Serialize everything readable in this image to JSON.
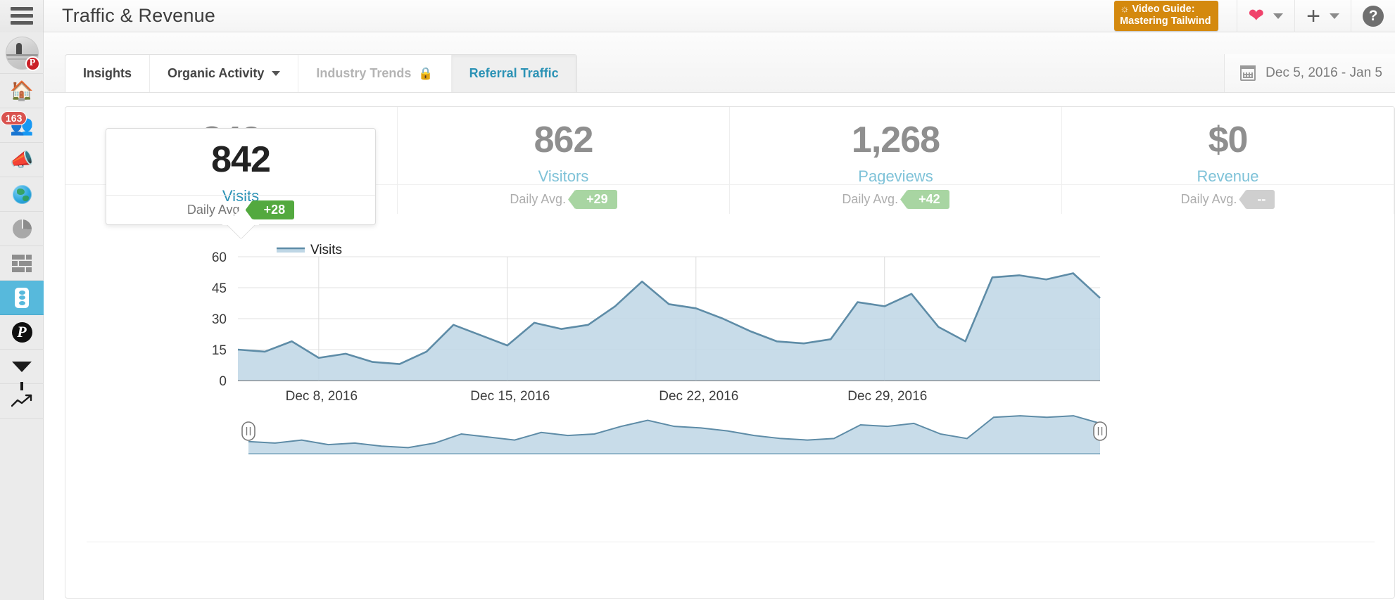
{
  "header": {
    "title": "Traffic & Revenue",
    "menu_icon": "hamburger-icon",
    "video_guide_line1": "Video Guide:",
    "video_guide_line2": "Mastering Tailwind",
    "video_guide_bulb": "♀",
    "heart_icon": "heart-icon",
    "plus_icon": "plus-icon",
    "help_icon": "question-mark-icon"
  },
  "sidebar": {
    "items": [
      {
        "name": "account-avatar",
        "icon": "avatar-pinterest-icon",
        "badge": ""
      },
      {
        "name": "home",
        "icon": "home-icon",
        "badge": ""
      },
      {
        "name": "community",
        "icon": "people-icon",
        "badge": "163"
      },
      {
        "name": "promote",
        "icon": "megaphone-icon",
        "badge": ""
      },
      {
        "name": "domain",
        "icon": "globe-icon",
        "badge": ""
      },
      {
        "name": "analytics",
        "icon": "pie-chart-icon",
        "badge": ""
      },
      {
        "name": "tiles",
        "icon": "grid-icon",
        "badge": ""
      },
      {
        "name": "traffic",
        "icon": "traffic-light-icon",
        "badge": ""
      },
      {
        "name": "pinterest",
        "icon": "pinterest-icon",
        "badge": ""
      },
      {
        "name": "funnel",
        "icon": "funnel-icon",
        "badge": ""
      },
      {
        "name": "trending",
        "icon": "trend-line-icon",
        "badge": ""
      }
    ],
    "active_index": 7
  },
  "tabs": [
    {
      "label": "Insights",
      "state": "normal",
      "has_caret": false,
      "has_lock": false
    },
    {
      "label": "Organic Activity",
      "state": "normal",
      "has_caret": true,
      "has_lock": false
    },
    {
      "label": "Industry Trends",
      "state": "disabled",
      "has_caret": false,
      "has_lock": true
    },
    {
      "label": "Referral Traffic",
      "state": "active",
      "has_caret": false,
      "has_lock": false
    }
  ],
  "date_range": {
    "icon": "calendar-icon",
    "value": "Dec 5, 2016 - Jan 5"
  },
  "kpis": [
    {
      "value": "842",
      "label": "Visits",
      "footer_label": "Daily Avg.",
      "delta": "+28",
      "delta_state": "positive",
      "active": true
    },
    {
      "value": "862",
      "label": "Visitors",
      "footer_label": "Daily Avg.",
      "delta": "+29",
      "delta_state": "positive",
      "active": false
    },
    {
      "value": "1,268",
      "label": "Pageviews",
      "footer_label": "Daily Avg.",
      "delta": "+42",
      "delta_state": "positive",
      "active": false
    },
    {
      "value": "$0",
      "label": "Revenue",
      "footer_label": "Daily Avg.",
      "delta": "--",
      "delta_state": "neutral",
      "active": false
    }
  ],
  "colors": {
    "accent": "#2b92b5",
    "kpi_label": "#7ec2d8",
    "badge_green": "#53a93f",
    "badge_green_muted": "#a8d5a2",
    "badge_gray": "#cfcfcf",
    "video_guide_bg": "#d4890e",
    "heart": "#f0426b",
    "sidebar_active": "#57b9dc",
    "series_line": "#5e8ca7",
    "series_fill": "#bed6e5"
  },
  "chart_data": {
    "type": "area",
    "title": "",
    "xlabel": "",
    "ylabel": "",
    "ylim": [
      0,
      60
    ],
    "yticks": [
      0,
      15,
      30,
      45,
      60
    ],
    "grid": true,
    "legend": {
      "position": "top-left",
      "entries": [
        "Visits"
      ]
    },
    "xtick_labels": [
      "Dec 8, 2016",
      "Dec 15, 2016",
      "Dec 22, 2016",
      "Dec 29, 2016"
    ],
    "xtick_indices": [
      3,
      10,
      17,
      24
    ],
    "x": [
      "Dec 5, 2016",
      "Dec 6, 2016",
      "Dec 7, 2016",
      "Dec 8, 2016",
      "Dec 9, 2016",
      "Dec 10, 2016",
      "Dec 11, 2016",
      "Dec 12, 2016",
      "Dec 13, 2016",
      "Dec 14, 2016",
      "Dec 15, 2016",
      "Dec 16, 2016",
      "Dec 17, 2016",
      "Dec 18, 2016",
      "Dec 19, 2016",
      "Dec 20, 2016",
      "Dec 21, 2016",
      "Dec 22, 2016",
      "Dec 23, 2016",
      "Dec 24, 2016",
      "Dec 25, 2016",
      "Dec 26, 2016",
      "Dec 27, 2016",
      "Dec 28, 2016",
      "Dec 29, 2016",
      "Dec 30, 2016",
      "Dec 31, 2016",
      "Jan 1, 2017",
      "Jan 2, 2017",
      "Jan 3, 2017",
      "Jan 4, 2017",
      "Jan 5, 2017"
    ],
    "series": [
      {
        "name": "Visits",
        "values": [
          15,
          14,
          19,
          11,
          13,
          9,
          8,
          14,
          27,
          22,
          17,
          28,
          25,
          27,
          36,
          48,
          37,
          35,
          30,
          24,
          19,
          18,
          20,
          38,
          36,
          42,
          26,
          19,
          50,
          51,
          49,
          52,
          40
        ]
      }
    ],
    "range_slider": {
      "visible": true,
      "left_handle": "left-range-handle",
      "right_handle": "right-range-handle",
      "overview_values": [
        8,
        7,
        9,
        6,
        7,
        5,
        4,
        7,
        13,
        11,
        9,
        14,
        12,
        13,
        18,
        22,
        18,
        17,
        15,
        12,
        10,
        9,
        10,
        19,
        18,
        20,
        13,
        10,
        24,
        25,
        24,
        25,
        20
      ]
    }
  }
}
